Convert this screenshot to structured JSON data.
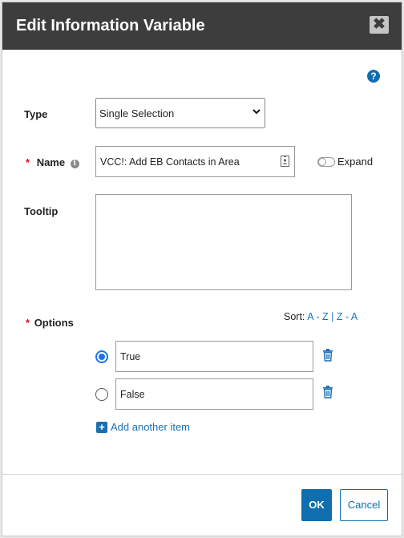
{
  "dialog": {
    "title": "Edit Information Variable",
    "close_glyph": "✖",
    "help_glyph": "?"
  },
  "form": {
    "type_label": "Type",
    "type_value": "Single Selection",
    "required_mark": "*",
    "name_label": "Name",
    "info_glyph": "i",
    "name_value": "VCC!: Add EB Contacts in Area",
    "expand_label": "Expand",
    "tooltip_label": "Tooltip",
    "tooltip_value": "",
    "options_label": "Options",
    "sort_label": "Sort:",
    "sort_az": "A - Z",
    "sort_sep": "|",
    "sort_za": "Z - A",
    "options": [
      {
        "value": "True",
        "selected": true
      },
      {
        "value": "False",
        "selected": false
      }
    ],
    "add_item_label": "Add another item",
    "add_glyph": "+"
  },
  "footer": {
    "ok_label": "OK",
    "cancel_label": "Cancel"
  },
  "colors": {
    "header_bg": "#3d3d3d",
    "primary": "#0f6fae",
    "required": "#c8102e",
    "radio_selected": "#1a73e8"
  },
  "icons": [
    "close-icon",
    "help-icon",
    "info-icon",
    "chevron-down-icon",
    "contact-card-icon",
    "toggle-icon",
    "trash-icon",
    "plus-icon"
  ]
}
